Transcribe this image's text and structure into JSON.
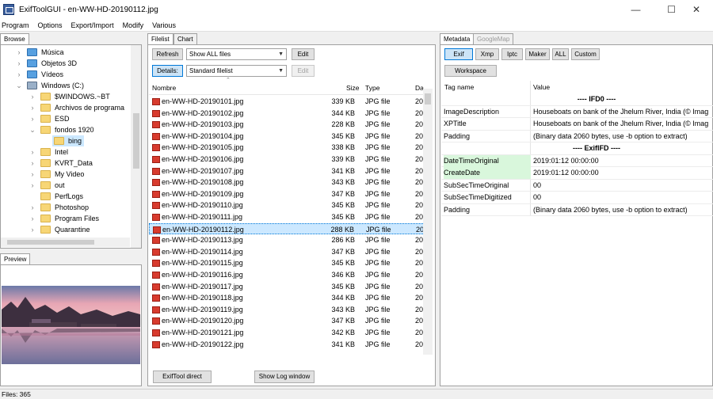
{
  "window": {
    "title": "ExifToolGUI - en-WW-HD-20190112.jpg",
    "minimize": "—",
    "maximize": "☐",
    "close": "✕"
  },
  "menu": [
    "Program",
    "Options",
    "Export/Import",
    "Modify",
    "Various"
  ],
  "left": {
    "browse_tab": "Browse",
    "tree": [
      {
        "label": "Música",
        "icon": "music-icon",
        "chev": "›"
      },
      {
        "label": "Objetos 3D",
        "icon": "3d-objects-icon",
        "chev": "›"
      },
      {
        "label": "Vídeos",
        "icon": "video-icon",
        "chev": "›"
      },
      {
        "label": "Windows (C:)",
        "icon": "drive-icon",
        "chev": "⌄"
      },
      {
        "label": "$WINDOWS.~BT",
        "icon": "folder-icon",
        "chev": "›"
      },
      {
        "label": "Archivos de programa",
        "icon": "folder-icon",
        "chev": "›"
      },
      {
        "label": "ESD",
        "icon": "folder-icon",
        "chev": "›"
      },
      {
        "label": "fondos 1920",
        "icon": "folder-icon",
        "chev": "⌄"
      },
      {
        "label": "bing",
        "icon": "folder-open-icon",
        "chev": ""
      },
      {
        "label": "Intel",
        "icon": "folder-icon",
        "chev": "›"
      },
      {
        "label": "KVRT_Data",
        "icon": "folder-icon",
        "chev": "›"
      },
      {
        "label": "My Video",
        "icon": "folder-icon",
        "chev": "›"
      },
      {
        "label": "out",
        "icon": "folder-icon",
        "chev": "›"
      },
      {
        "label": "PerfLogs",
        "icon": "folder-icon",
        "chev": ""
      },
      {
        "label": "Photoshop",
        "icon": "folder-icon",
        "chev": "›"
      },
      {
        "label": "Program Files",
        "icon": "folder-icon",
        "chev": "›"
      },
      {
        "label": "Quarantine",
        "icon": "folder-icon",
        "chev": "›"
      }
    ],
    "preview_tab": "Preview"
  },
  "center": {
    "tabs": [
      "Filelist",
      "Chart"
    ],
    "refresh": "Refresh",
    "filter": "Show ALL files",
    "edit": "Edit",
    "details": "Details:",
    "view": "Standard filelist",
    "edit2": "Edit",
    "headers": {
      "name": "Nombre",
      "size": "Size",
      "type": "Type",
      "date": "Da"
    },
    "files": [
      {
        "name": "en-WW-HD-20190101.jpg",
        "size": "339 KB",
        "type": "JPG file",
        "date": "20"
      },
      {
        "name": "en-WW-HD-20190102.jpg",
        "size": "344 KB",
        "type": "JPG file",
        "date": "20"
      },
      {
        "name": "en-WW-HD-20190103.jpg",
        "size": "228 KB",
        "type": "JPG file",
        "date": "20"
      },
      {
        "name": "en-WW-HD-20190104.jpg",
        "size": "345 KB",
        "type": "JPG file",
        "date": "20"
      },
      {
        "name": "en-WW-HD-20190105.jpg",
        "size": "338 KB",
        "type": "JPG file",
        "date": "20"
      },
      {
        "name": "en-WW-HD-20190106.jpg",
        "size": "339 KB",
        "type": "JPG file",
        "date": "20"
      },
      {
        "name": "en-WW-HD-20190107.jpg",
        "size": "341 KB",
        "type": "JPG file",
        "date": "20"
      },
      {
        "name": "en-WW-HD-20190108.jpg",
        "size": "343 KB",
        "type": "JPG file",
        "date": "20"
      },
      {
        "name": "en-WW-HD-20190109.jpg",
        "size": "347 KB",
        "type": "JPG file",
        "date": "20"
      },
      {
        "name": "en-WW-HD-20190110.jpg",
        "size": "345 KB",
        "type": "JPG file",
        "date": "20"
      },
      {
        "name": "en-WW-HD-20190111.jpg",
        "size": "345 KB",
        "type": "JPG file",
        "date": "20"
      },
      {
        "name": "en-WW-HD-20190112.jpg",
        "size": "288 KB",
        "type": "JPG file",
        "date": "20"
      },
      {
        "name": "en-WW-HD-20190113.jpg",
        "size": "286 KB",
        "type": "JPG file",
        "date": "20"
      },
      {
        "name": "en-WW-HD-20190114.jpg",
        "size": "347 KB",
        "type": "JPG file",
        "date": "20"
      },
      {
        "name": "en-WW-HD-20190115.jpg",
        "size": "345 KB",
        "type": "JPG file",
        "date": "20"
      },
      {
        "name": "en-WW-HD-20190116.jpg",
        "size": "346 KB",
        "type": "JPG file",
        "date": "20"
      },
      {
        "name": "en-WW-HD-20190117.jpg",
        "size": "345 KB",
        "type": "JPG file",
        "date": "20"
      },
      {
        "name": "en-WW-HD-20190118.jpg",
        "size": "344 KB",
        "type": "JPG file",
        "date": "20"
      },
      {
        "name": "en-WW-HD-20190119.jpg",
        "size": "343 KB",
        "type": "JPG file",
        "date": "20"
      },
      {
        "name": "en-WW-HD-20190120.jpg",
        "size": "347 KB",
        "type": "JPG file",
        "date": "20"
      },
      {
        "name": "en-WW-HD-20190121.jpg",
        "size": "342 KB",
        "type": "JPG file",
        "date": "20"
      },
      {
        "name": "en-WW-HD-20190122.jpg",
        "size": "341 KB",
        "type": "JPG file",
        "date": "20"
      }
    ],
    "selected_index": 11,
    "exiftool_direct": "ExifTool direct",
    "show_log": "Show Log window"
  },
  "right": {
    "tabs": [
      "Metadata",
      "GoogleMap"
    ],
    "buttons": [
      "Exif",
      "Xmp",
      "Iptc",
      "Maker",
      "ALL",
      "Custom"
    ],
    "workspace": "Workspace",
    "headers": {
      "tag": "Tag name",
      "value": "Value"
    },
    "rows": [
      {
        "tag": "",
        "value": "---- IFD0 ----",
        "kind": "section"
      },
      {
        "tag": "ImageDescription",
        "value": "Houseboats on bank of the Jhelum River, India (© Imag",
        "kind": ""
      },
      {
        "tag": "XPTitle",
        "value": "Houseboats on bank of the Jhelum River, India (© Imag",
        "kind": ""
      },
      {
        "tag": "Padding",
        "value": "(Binary data 2060 bytes, use -b option to extract)",
        "kind": ""
      },
      {
        "tag": "",
        "value": "---- ExifIFD ----",
        "kind": "section"
      },
      {
        "tag": "DateTimeOriginal",
        "value": "2019:01:12 00:00:00",
        "kind": "green"
      },
      {
        "tag": "CreateDate",
        "value": "2019:01:12 00:00:00",
        "kind": "green"
      },
      {
        "tag": "SubSecTimeOriginal",
        "value": "00",
        "kind": ""
      },
      {
        "tag": "SubSecTimeDigitized",
        "value": "00",
        "kind": ""
      },
      {
        "tag": "Padding",
        "value": "(Binary data 2060 bytes, use -b option to extract)",
        "kind": ""
      }
    ]
  },
  "status": "Files: 365"
}
